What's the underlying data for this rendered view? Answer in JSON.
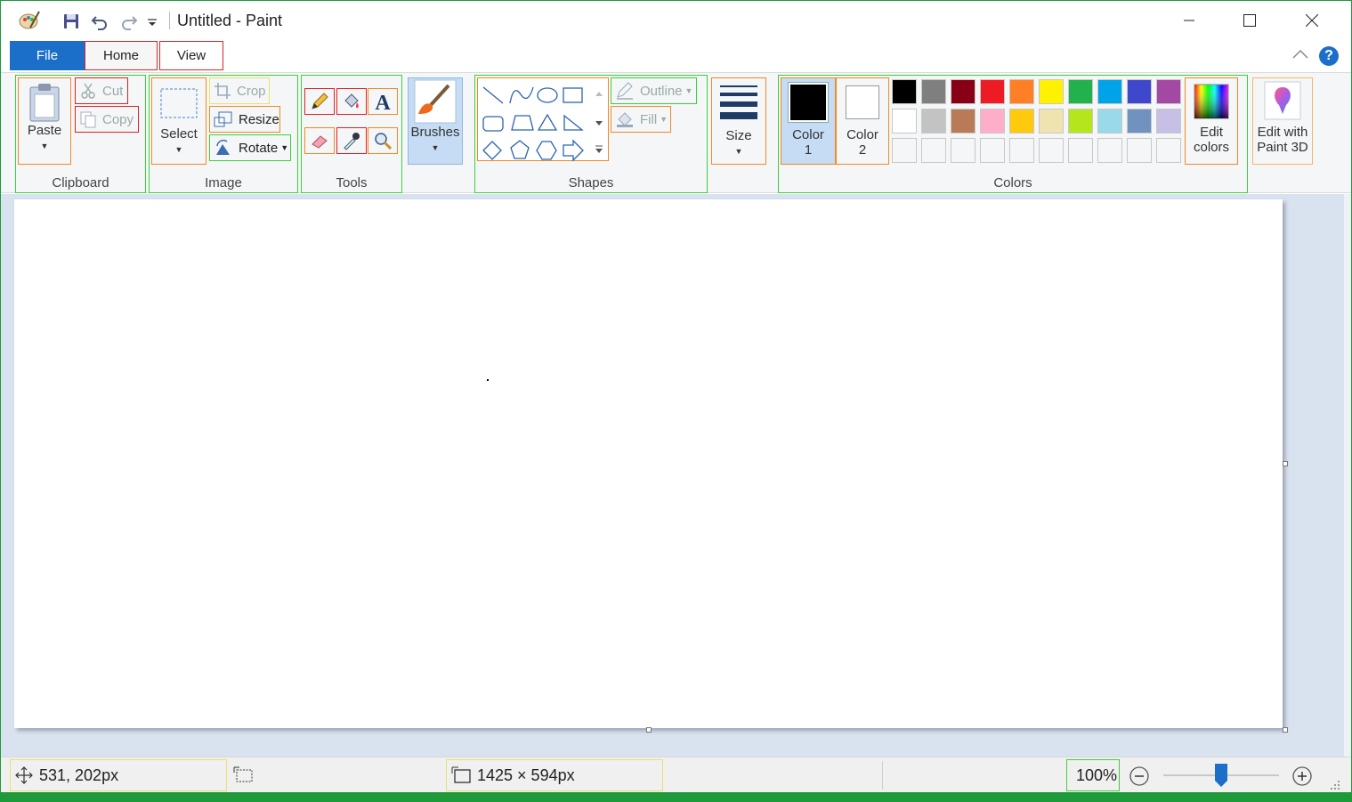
{
  "window": {
    "title": "Untitled - Paint"
  },
  "tabs": {
    "file": "File",
    "home": "Home",
    "view": "View"
  },
  "clipboard": {
    "paste": "Paste",
    "cut": "Cut",
    "copy": "Copy",
    "label": "Clipboard"
  },
  "image": {
    "select": "Select",
    "crop": "Crop",
    "resize": "Resize",
    "rotate": "Rotate",
    "label": "Image"
  },
  "tools": {
    "label": "Tools"
  },
  "brushes": {
    "label": "Brushes"
  },
  "shapes": {
    "outline": "Outline",
    "fill": "Fill",
    "label": "Shapes"
  },
  "size": {
    "label": "Size"
  },
  "colors": {
    "color1_line1": "Color",
    "color1_line2": "1",
    "color2_line1": "Color",
    "color2_line2": "2",
    "edit_line1": "Edit",
    "edit_line2": "colors",
    "label": "Colors",
    "color1_value": "#000000",
    "color2_value": "#ffffff",
    "palette_row1": [
      "#000000",
      "#7f7f7f",
      "#880015",
      "#ed1c24",
      "#ff7f27",
      "#fff200",
      "#22b14c",
      "#00a2e8",
      "#3f48cc",
      "#a349a4"
    ],
    "palette_row2": [
      "#ffffff",
      "#c3c3c3",
      "#b97a57",
      "#ffaec9",
      "#ffc90e",
      "#efe4b0",
      "#b5e61d",
      "#99d9ea",
      "#7092be",
      "#c8bfe7"
    ],
    "palette_row3": [
      "#f5f6f7",
      "#f5f6f7",
      "#f5f6f7",
      "#f5f6f7",
      "#f5f6f7",
      "#f5f6f7",
      "#f5f6f7",
      "#f5f6f7",
      "#f5f6f7",
      "#f5f6f7"
    ]
  },
  "paint3d": {
    "line1": "Edit with",
    "line2": "Paint 3D"
  },
  "status": {
    "cursor_position": "531, 202px",
    "canvas_size": "1425 × 594px",
    "zoom": "100%"
  }
}
